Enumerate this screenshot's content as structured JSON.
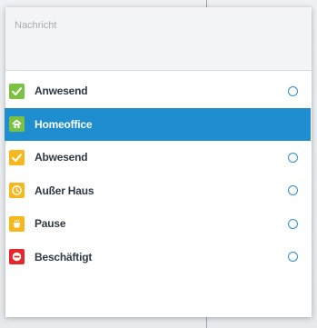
{
  "message": {
    "placeholder": "Nachricht",
    "value": ""
  },
  "statuses": [
    {
      "label": "Anwesend",
      "icon": "checkmark-icon",
      "color": "#7cc242",
      "selected": false
    },
    {
      "label": "Homeoffice",
      "icon": "house-icon",
      "color": "#7cc242",
      "selected": true
    },
    {
      "label": "Abwesend",
      "icon": "checkmark-icon",
      "color": "#f6b81c",
      "selected": false
    },
    {
      "label": "Außer Haus",
      "icon": "clock-icon",
      "color": "#f6b81c",
      "selected": false
    },
    {
      "label": "Pause",
      "icon": "coffee-cup-icon",
      "color": "#f6b81c",
      "selected": false
    },
    {
      "label": "Beschäftigt",
      "icon": "minus-circle-icon",
      "color": "#e5262b",
      "selected": false
    }
  ],
  "colors": {
    "selection": "#1e8ed1",
    "radio": "#2b8fd0"
  }
}
